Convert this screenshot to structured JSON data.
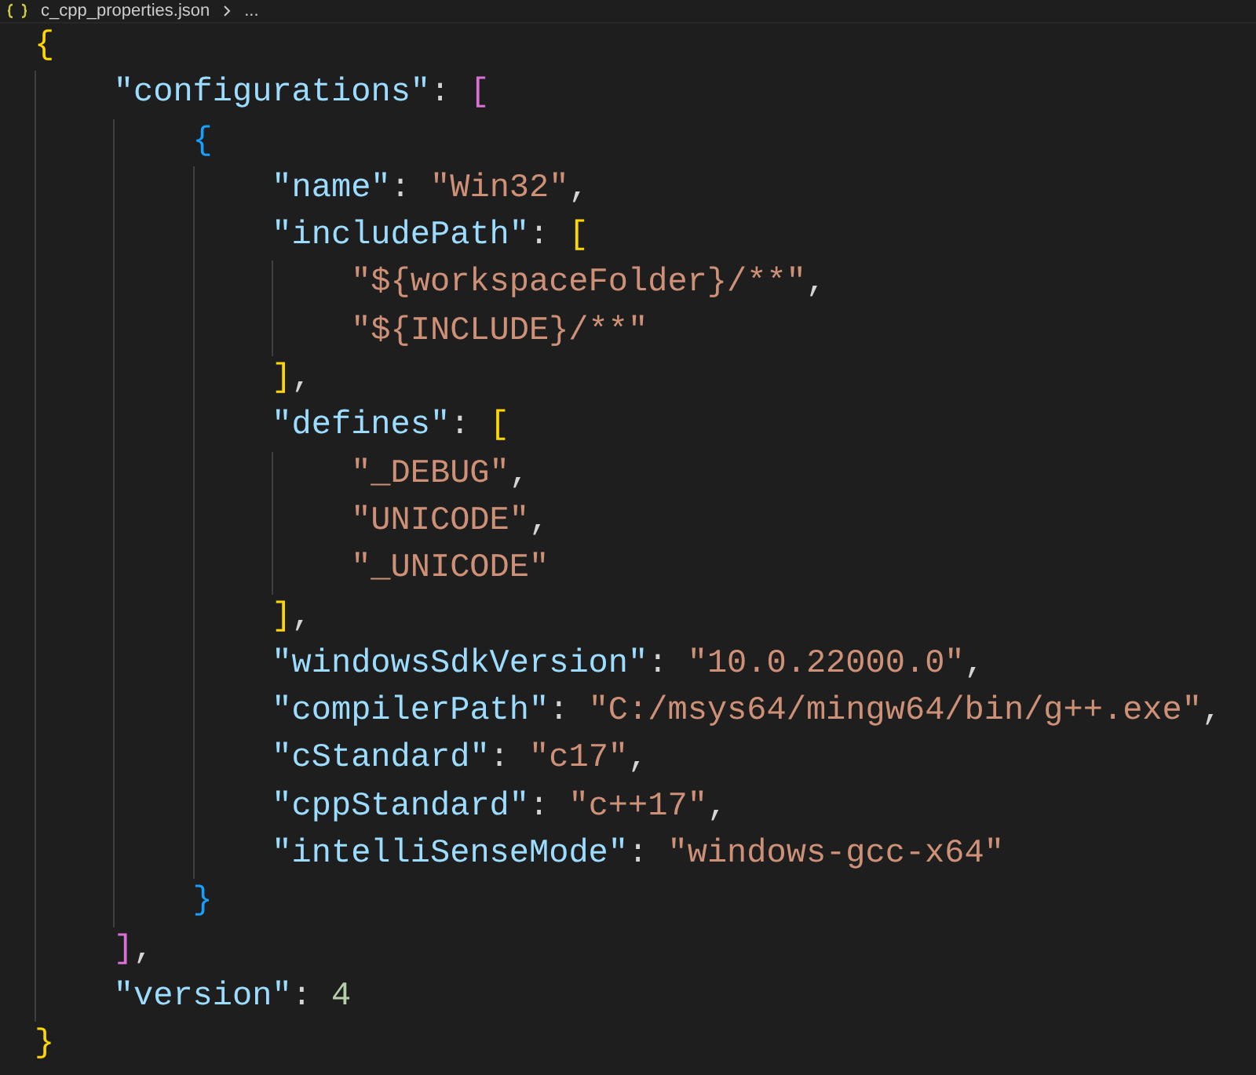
{
  "breadcrumb": {
    "items": [
      "c_cpp_properties.json",
      "..."
    ]
  },
  "code": [
    {
      "tokens": [
        {
          "kind": "bracket",
          "text": "{",
          "color": "#ffd700"
        }
      ],
      "children": [
        {
          "tokens": [
            {
              "kind": "key",
              "text": "\"configurations\""
            },
            {
              "kind": "punct",
              "text": ": "
            },
            {
              "kind": "bracket",
              "text": "[",
              "color": "#da70d6"
            }
          ],
          "children": [
            {
              "tokens": [
                {
                  "kind": "bracket",
                  "text": "{",
                  "color": "#179fff"
                }
              ],
              "children": [
                {
                  "tokens": [
                    {
                      "kind": "key",
                      "text": "\"name\""
                    },
                    {
                      "kind": "punct",
                      "text": ": "
                    },
                    {
                      "kind": "string",
                      "text": "\"Win32\""
                    },
                    {
                      "kind": "punct",
                      "text": ","
                    }
                  ]
                },
                {
                  "tokens": [
                    {
                      "kind": "key",
                      "text": "\"includePath\""
                    },
                    {
                      "kind": "punct",
                      "text": ": "
                    },
                    {
                      "kind": "bracket",
                      "text": "[",
                      "color": "#ffd700"
                    }
                  ],
                  "children": [
                    {
                      "tokens": [
                        {
                          "kind": "string",
                          "text": "\"${workspaceFolder}/**\""
                        },
                        {
                          "kind": "punct",
                          "text": ","
                        }
                      ]
                    },
                    {
                      "tokens": [
                        {
                          "kind": "string",
                          "text": "\"${INCLUDE}/**\""
                        }
                      ]
                    }
                  ]
                },
                {
                  "tokens": [
                    {
                      "kind": "bracket",
                      "text": "]",
                      "color": "#ffd700"
                    },
                    {
                      "kind": "punct",
                      "text": ","
                    }
                  ]
                },
                {
                  "tokens": [
                    {
                      "kind": "key",
                      "text": "\"defines\""
                    },
                    {
                      "kind": "punct",
                      "text": ": "
                    },
                    {
                      "kind": "bracket",
                      "text": "[",
                      "color": "#ffd700"
                    }
                  ],
                  "children": [
                    {
                      "tokens": [
                        {
                          "kind": "string",
                          "text": "\"_DEBUG\""
                        },
                        {
                          "kind": "punct",
                          "text": ","
                        }
                      ]
                    },
                    {
                      "tokens": [
                        {
                          "kind": "string",
                          "text": "\"UNICODE\""
                        },
                        {
                          "kind": "punct",
                          "text": ","
                        }
                      ]
                    },
                    {
                      "tokens": [
                        {
                          "kind": "string",
                          "text": "\"_UNICODE\""
                        }
                      ]
                    }
                  ]
                },
                {
                  "tokens": [
                    {
                      "kind": "bracket",
                      "text": "]",
                      "color": "#ffd700"
                    },
                    {
                      "kind": "punct",
                      "text": ","
                    }
                  ]
                },
                {
                  "tokens": [
                    {
                      "kind": "key",
                      "text": "\"windowsSdkVersion\""
                    },
                    {
                      "kind": "punct",
                      "text": ": "
                    },
                    {
                      "kind": "string",
                      "text": "\"10.0.22000.0\""
                    },
                    {
                      "kind": "punct",
                      "text": ","
                    }
                  ]
                },
                {
                  "tokens": [
                    {
                      "kind": "key",
                      "text": "\"compilerPath\""
                    },
                    {
                      "kind": "punct",
                      "text": ": "
                    },
                    {
                      "kind": "string",
                      "text": "\"C:/msys64/mingw64/bin/g++.exe\""
                    },
                    {
                      "kind": "punct",
                      "text": ","
                    }
                  ]
                },
                {
                  "tokens": [
                    {
                      "kind": "key",
                      "text": "\"cStandard\""
                    },
                    {
                      "kind": "punct",
                      "text": ": "
                    },
                    {
                      "kind": "string",
                      "text": "\"c17\""
                    },
                    {
                      "kind": "punct",
                      "text": ","
                    }
                  ]
                },
                {
                  "tokens": [
                    {
                      "kind": "key",
                      "text": "\"cppStandard\""
                    },
                    {
                      "kind": "punct",
                      "text": ": "
                    },
                    {
                      "kind": "string",
                      "text": "\"c++17\""
                    },
                    {
                      "kind": "punct",
                      "text": ","
                    }
                  ]
                },
                {
                  "tokens": [
                    {
                      "kind": "key",
                      "text": "\"intelliSenseMode\""
                    },
                    {
                      "kind": "punct",
                      "text": ": "
                    },
                    {
                      "kind": "string",
                      "text": "\"windows-gcc-x64\""
                    }
                  ]
                }
              ]
            },
            {
              "tokens": [
                {
                  "kind": "bracket",
                  "text": "}",
                  "color": "#179fff"
                }
              ]
            }
          ]
        },
        {
          "tokens": [
            {
              "kind": "bracket",
              "text": "]",
              "color": "#da70d6"
            },
            {
              "kind": "punct",
              "text": ","
            }
          ]
        },
        {
          "tokens": [
            {
              "kind": "key",
              "text": "\"version\""
            },
            {
              "kind": "punct",
              "text": ": "
            },
            {
              "kind": "number",
              "text": "4"
            }
          ]
        }
      ]
    },
    {
      "tokens": [
        {
          "kind": "bracket",
          "text": "}",
          "color": "#ffd700"
        }
      ]
    }
  ]
}
